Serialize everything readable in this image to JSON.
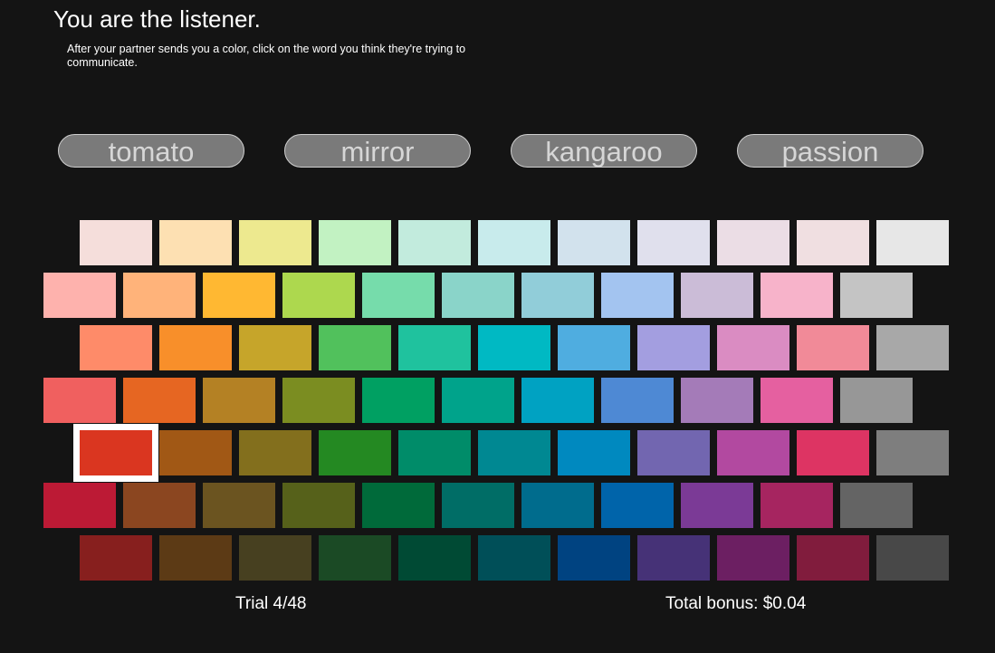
{
  "header": {
    "title": "You are the listener.",
    "instructions": "After your partner sends you a color, click on the word you think they're trying to communicate."
  },
  "words": [
    "tomato",
    "mirror",
    "kangaroo",
    "passion"
  ],
  "colors": {
    "button_fill": "#7a7a7a",
    "button_text": "#d6d6d6",
    "selection_border": "#ffffff",
    "background": "#141414"
  },
  "palette": {
    "rows": [
      [
        "#f5dedb",
        "#fde0b2",
        "#ede98f",
        "#c2f2c2",
        "#c2ebdd",
        "#c8ebec",
        "#d2e2ed",
        "#e0e0ed",
        "#ebdde5",
        "#f0dfe1",
        "#e7e7e7"
      ],
      [
        "#feb2ad",
        "#ffb37a",
        "#ffb832",
        "#add84e",
        "#76dcab",
        "#8ad4c9",
        "#91cdd9",
        "#a3c4f0",
        "#cbbcd7",
        "#f7b3ca",
        "#c4c4c4"
      ],
      [
        "#fe8b69",
        "#f88f2a",
        "#c6a52a",
        "#51c15c",
        "#1fc29e",
        "#00b9c3",
        "#4fade0",
        "#a39ee0",
        "#da8cc2",
        "#f18a98",
        "#a8a8a8"
      ],
      [
        "#f0605f",
        "#e66622",
        "#b48124",
        "#7b8d21",
        "#00a062",
        "#00a38b",
        "#00a2c2",
        "#4e89d4",
        "#a47bb8",
        "#e560a0",
        "#979797"
      ],
      [
        "#da3620",
        "#a15815",
        "#836f1d",
        "#248922",
        "#008c69",
        "#008892",
        "#0089bf",
        "#7266b0",
        "#b249a0",
        "#dd3463",
        "#7e7e7e"
      ],
      [
        "#bc1a35",
        "#8b4620",
        "#6b5420",
        "#56611a",
        "#006a3a",
        "#006d66",
        "#006c8d",
        "#0064aa",
        "#7b3a96",
        "#a62560",
        "#646464"
      ],
      [
        "#871f1e",
        "#5c3a15",
        "#474020",
        "#1b4a25",
        "#004a34",
        "#004f58",
        "#004381",
        "#463277",
        "#6c1f62",
        "#811c3d",
        "#484848"
      ]
    ],
    "selected": {
      "row": 4,
      "col": 0
    }
  },
  "footer": {
    "trial": "Trial 4/48",
    "bonus": "Total bonus: $0.04"
  }
}
